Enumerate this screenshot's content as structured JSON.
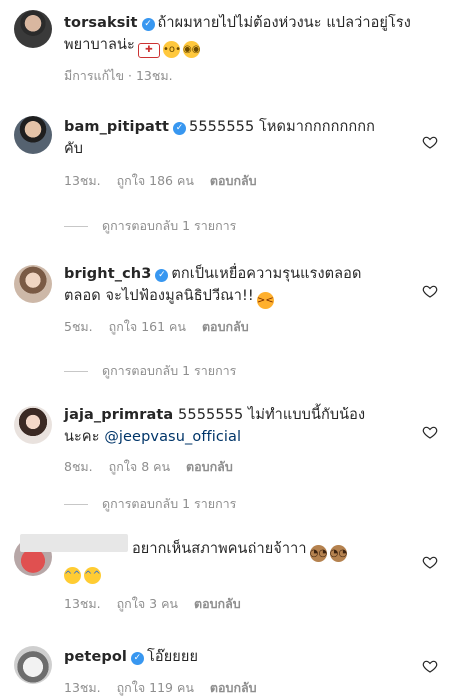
{
  "caption": {
    "username": "torsaksit",
    "line1": "ถ้าผมหายไปไม่ต้องห่วงนะ แปลว่าอยู่โรง",
    "line2": "พยาบาลน่ะ",
    "edited": "มีการแก้ไข",
    "time": "13ชม.",
    "avatar_icon": "profile-photo-icon"
  },
  "comments": [
    {
      "username": "bam_pitipatt",
      "line1": "5555555 โหดมากกกกกกกก",
      "line2": "คับ",
      "time": "13ชม.",
      "likes": "ถูกใจ 186 คน",
      "reply": "ตอบกลับ",
      "view_replies": "ดูการตอบกลับ 1 รายการ"
    },
    {
      "username": "bright_ch3",
      "line1": "ตกเป็นเหยื่อความรุนแรงตลอด",
      "line2": "ตลอด จะไปฟ้องมูลนิธิปวีณา!!",
      "time": "5ชม.",
      "likes": "ถูกใจ 161 คน",
      "reply": "ตอบกลับ",
      "view_replies": "ดูการตอบกลับ 1 รายการ"
    },
    {
      "username": "jaja_primrata",
      "line1": "5555555 ไม่ทำแบบนี้กับน้อง",
      "line2_prefix": "นะคะ",
      "mention": "@jeepvasu_official",
      "time": "8ชม.",
      "likes": "ถูกใจ 8 คน",
      "reply": "ตอบกลับ",
      "view_replies": "ดูการตอบกลับ 1 รายการ"
    },
    {
      "username": "",
      "line1": "อยากเห็นสภาพคนถ่ายจ้าาา",
      "time": "13ชม.",
      "likes": "ถูกใจ 3 คน",
      "reply": "ตอบกลับ"
    },
    {
      "username": "petepol",
      "line1": "โอ๊ยยยย",
      "time": "13ชม.",
      "likes": "ถูกใจ 119 คน",
      "reply": "ตอบกลับ"
    }
  ],
  "icons": {
    "verified": "verified-badge-icon",
    "like": "heart-icon"
  },
  "colors": {
    "text": "#262626",
    "meta": "#8e8e8e",
    "verified": "#3897f0",
    "mention": "#003569"
  }
}
